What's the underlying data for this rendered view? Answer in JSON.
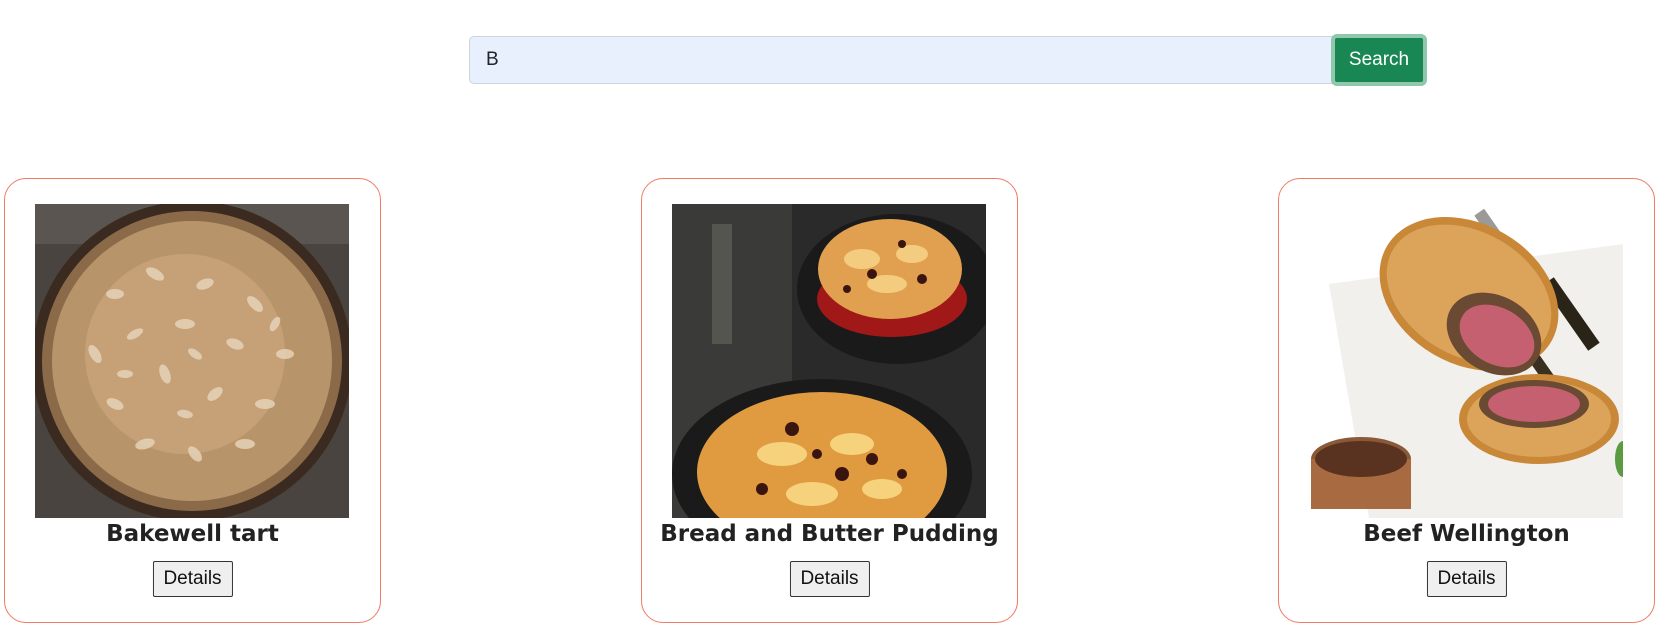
{
  "search": {
    "value": "B",
    "placeholder": "",
    "button_label": "Search"
  },
  "recipes": [
    {
      "title": "Bakewell tart",
      "button_label": "Details"
    },
    {
      "title": "Bread and Butter Pudding",
      "button_label": "Details"
    },
    {
      "title": "Beef Wellington",
      "button_label": "Details"
    }
  ],
  "colors": {
    "accent": "#198754",
    "card_border": "#f07a65",
    "input_background": "#e8f0fe"
  }
}
